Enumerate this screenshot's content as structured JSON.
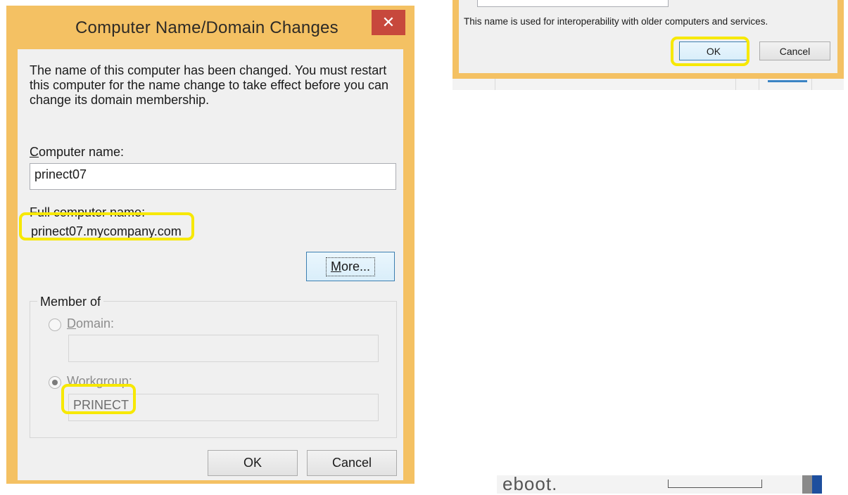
{
  "dialog": {
    "title": "Computer Name/Domain Changes",
    "close_glyph": "✕",
    "message": "The name of this computer has been changed.  You must restart this computer for the name change to take effect before you can change its domain membership.",
    "computer_name_label_first": "C",
    "computer_name_label_rest": "omputer name:",
    "computer_name_value": "prinect07",
    "full_name_label": "Full computer name:",
    "full_name_value": "prinect07.mycompany.com",
    "more_button_u": "M",
    "more_button_rest": "ore...",
    "member_of_title": "Member of",
    "domain_label_u": "D",
    "domain_label_rest": "omain:",
    "domain_value": "",
    "workgroup_label_u": "W",
    "workgroup_label_rest": "orkgroup:",
    "workgroup_value": "PRINECT",
    "selected_membership": "workgroup",
    "ok_label": "OK",
    "cancel_label": "Cancel"
  },
  "background_dialog": {
    "info_text": "This name is used for interoperability with older computers and services.",
    "ok_label": "OK",
    "cancel_label": "Cancel"
  },
  "background_fragment": {
    "text": "eboot."
  },
  "colors": {
    "frame": "#f4c163",
    "close_button": "#c7483c",
    "highlight": "#f7e800",
    "client": "#f0f0f0"
  }
}
